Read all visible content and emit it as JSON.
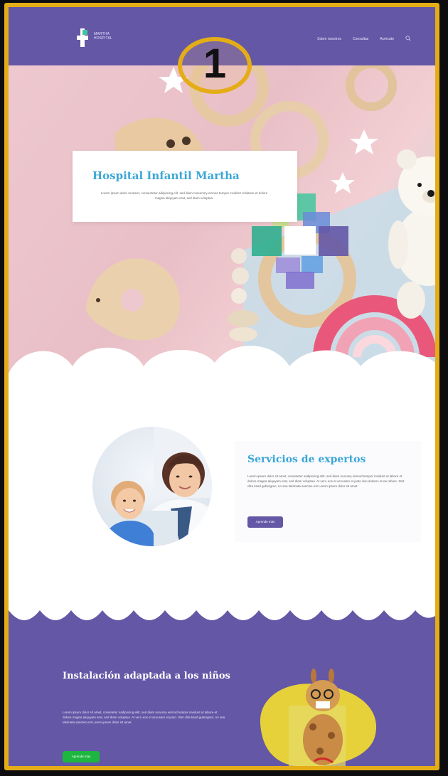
{
  "annotation": {
    "number": "1"
  },
  "header": {
    "logo_text": "MARTHA HOSPITAL",
    "nav": [
      "Sobre nosotros",
      "Consultas",
      "Acércate"
    ]
  },
  "hero": {
    "title": "Hospital Infantil Martha",
    "text": "Lorem ipsum dolor sit amet, consectetur adipiscing elit, sed diam nonummy eirmod tempor incidunt ut labore et dolore magna aliquyam erat, sed diam voluptua."
  },
  "services": {
    "title": "Servicios de expertos",
    "text": "Lorem ipsum dolor sit amet, consetetur sadipscing elitr, sed diam nonumy eirmod tempor invidunt ut labore et dolore magna aliquyam erat, sed diam voluptua. At vero eos et accusam et justo duo dolores et ea rebum. Stet clita kasd gubergren, no sea takimata sanctus est Lorem ipsum dolor sit amet.",
    "button": "Aprende más"
  },
  "facility": {
    "title": "Instalación adaptada a los niños",
    "text": "Lorem ipsum dolor sit amet, consetetur sadipscing elitr, sed diam nonumy eirmod tempor invidunt ut labore et dolore magna aliquyam erat, sed diam voluptua. At vero eos et accusam et justo. Stet clita kasd gubergren, no sea takimata sanctus est Lorem ipsum dolor sit amet.",
    "button": "Aprende más"
  },
  "colors": {
    "frame": "#e4ad17",
    "brand_purple": "#6457a6",
    "title_blue": "#3aa6d6",
    "green_button": "#1db63f",
    "hero_pink": "#eec8cf"
  }
}
